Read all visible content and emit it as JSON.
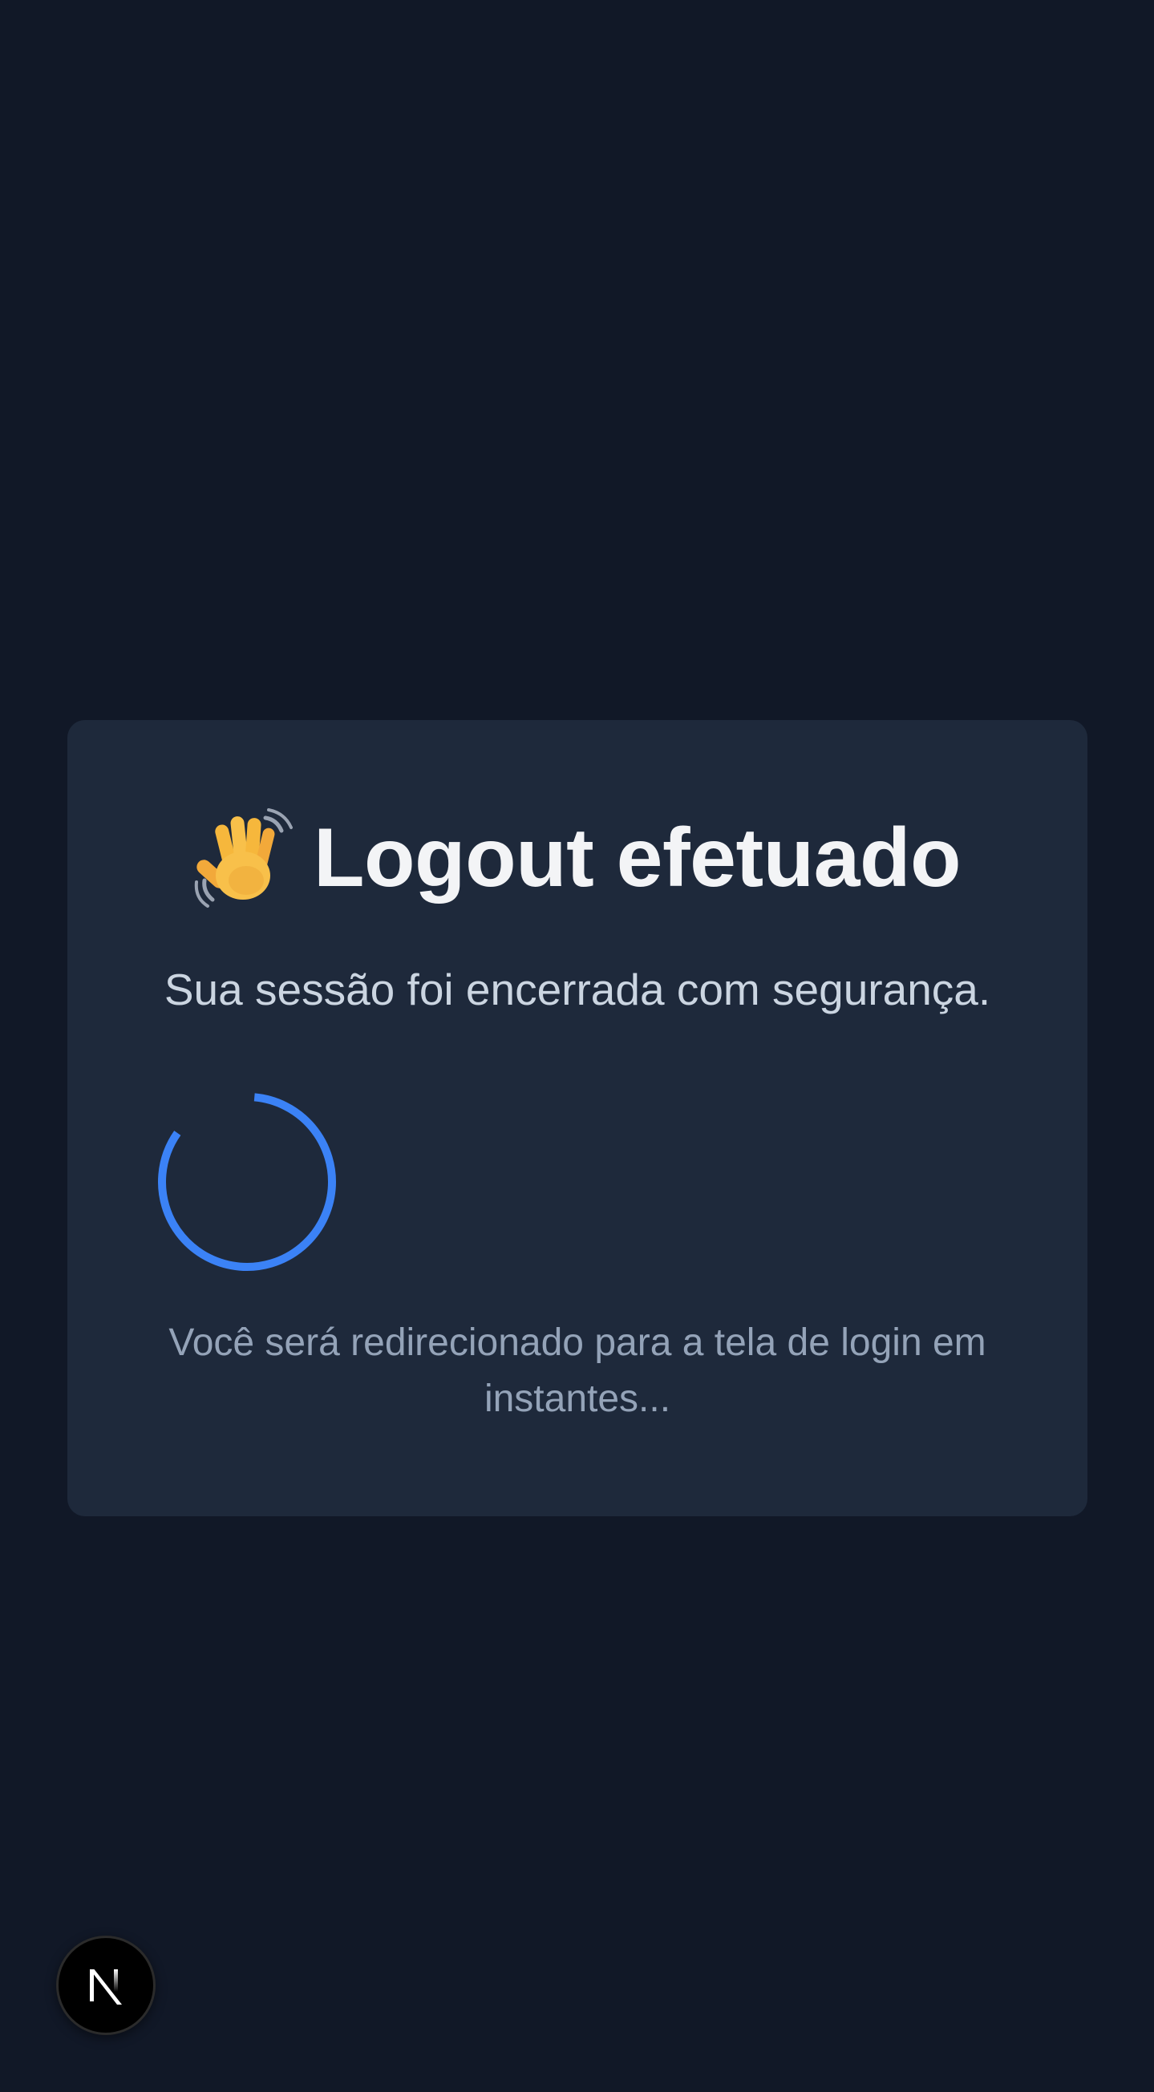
{
  "card": {
    "title": "Logout efetuado",
    "subtitle": "Sua sessão foi encerrada com segurança.",
    "redirect_message": "Você será redirecionado para a tela de login em instantes..."
  },
  "icons": {
    "title_icon": "waving-hand-icon",
    "loader": "loading-spinner-icon",
    "dev_badge": "nextjs-logo-icon"
  },
  "colors": {
    "background": "#111827",
    "card": "#1e293b",
    "title": "#f3f4f6",
    "subtitle": "#cbd5e1",
    "muted_text": "#94a3b8",
    "spinner": "#3b82f6"
  }
}
